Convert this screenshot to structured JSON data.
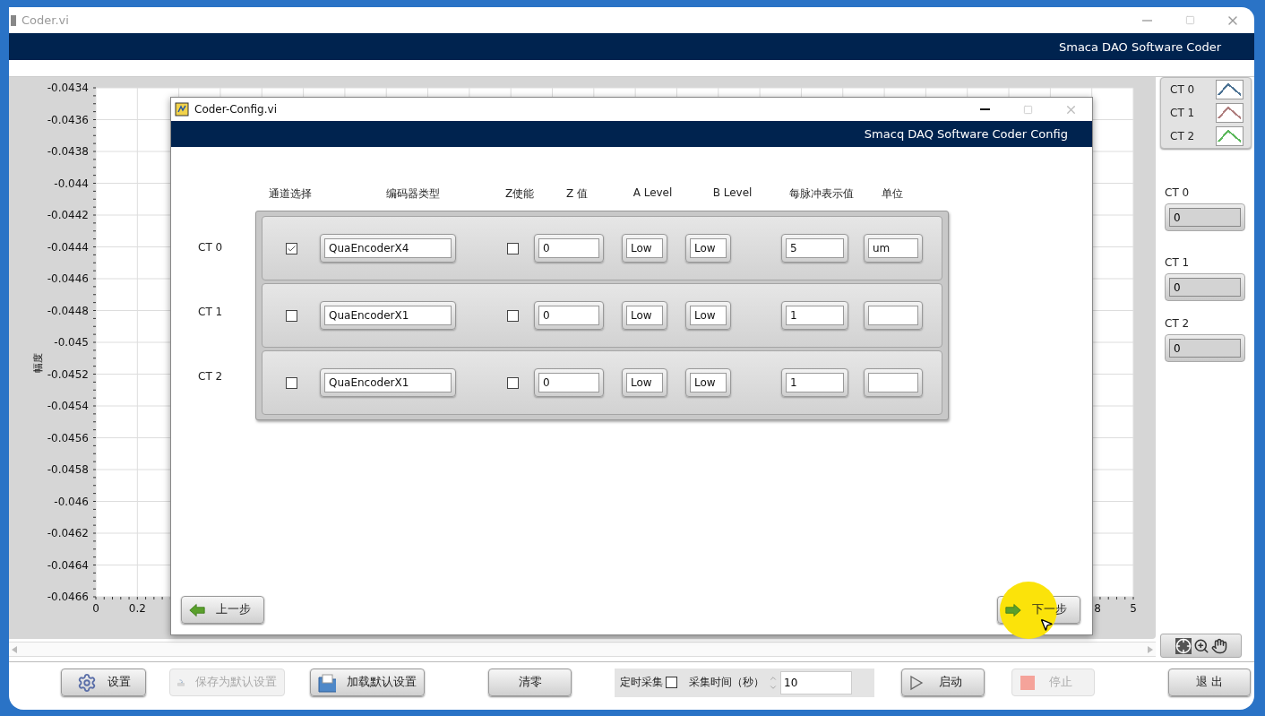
{
  "window": {
    "title": "Coder.vi",
    "banner": "Smaca DAO Software Coder"
  },
  "graph": {
    "chart_data": {
      "type": "line",
      "grid": true,
      "ylabel": "幅度",
      "xlim": [
        0,
        5
      ],
      "ylim": [
        -0.0466,
        -0.0434
      ],
      "xticks": [
        0,
        0.2,
        5
      ],
      "yticks": [
        -0.0434,
        -0.0436,
        -0.0438,
        -0.044,
        -0.0442,
        -0.0444,
        -0.0446,
        -0.0448,
        -0.045,
        -0.0452,
        -0.0454,
        -0.0456,
        -0.0458,
        -0.046,
        -0.0462,
        -0.0464,
        -0.0466
      ]
    },
    "partly_covered_x_tick": "8"
  },
  "legend": [
    {
      "label": "CT 0",
      "color": "#4d7394"
    },
    {
      "label": "CT 1",
      "color": "#b08080"
    },
    {
      "label": "CT 2",
      "color": "#5cb85c"
    }
  ],
  "indicators": [
    {
      "label": "CT 0",
      "value": "0"
    },
    {
      "label": "CT 1",
      "value": "0"
    },
    {
      "label": "CT 2",
      "value": "0"
    }
  ],
  "dialog": {
    "title": "Coder-Config.vi",
    "banner": "Smacq DAQ Software Coder Config",
    "columns": [
      "通道选择",
      "编码器类型",
      "Z使能",
      "Z 值",
      "A Level",
      "B Level",
      "每脉冲表示值",
      "单位"
    ],
    "rows": [
      {
        "label": "CT 0",
        "checked": true,
        "encoder": "QuaEncoderX4",
        "z_enable": false,
        "z_value": "0",
        "a_level": "Low",
        "b_level": "Low",
        "per_pulse": "5",
        "unit": "um"
      },
      {
        "label": "CT 1",
        "checked": false,
        "encoder": "QuaEncoderX1",
        "z_enable": false,
        "z_value": "0",
        "a_level": "Low",
        "b_level": "Low",
        "per_pulse": "1"
      },
      {
        "label": "CT 2",
        "checked": false,
        "encoder": "QuaEncoderX1",
        "z_enable": false,
        "z_value": "0",
        "a_level": "Low",
        "b_level": "Low",
        "per_pulse": "1"
      }
    ],
    "back_button": "上一步",
    "next_button": "下一步"
  },
  "toolbar": {
    "buttons": [
      {
        "label": "设置",
        "kind": "settings",
        "disabled": false
      },
      {
        "label": "保存为默认设置",
        "kind": "save",
        "disabled": true
      },
      {
        "label": "加载默认设置",
        "kind": "load",
        "disabled": false
      },
      {
        "label": "清零",
        "kind": "plain",
        "disabled": false
      }
    ],
    "timed": {
      "label": "定时采集",
      "checked": false
    },
    "duration": {
      "label": "采集时间（秒）",
      "value": "10"
    },
    "actions": [
      {
        "label": "启动",
        "kind": "start",
        "disabled": false
      },
      {
        "label": "停止",
        "kind": "stop",
        "disabled": true
      },
      {
        "label": "退 出",
        "kind": "exit",
        "disabled": false
      }
    ]
  }
}
